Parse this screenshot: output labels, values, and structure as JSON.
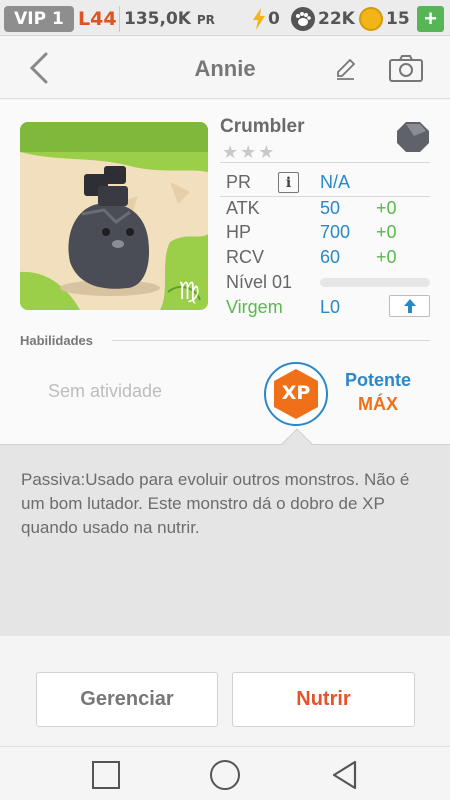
{
  "status_bar": {
    "vip": "VIP 1",
    "level": "L44",
    "pr_value": "135,0K",
    "pr_unit": "PR",
    "energy": "0",
    "paw_count": "22K",
    "coins": "15",
    "plus": "+"
  },
  "header": {
    "title": "Annie"
  },
  "monster": {
    "name": "Crumbler",
    "stars": "★★★",
    "sign_icon": "♍",
    "stats": {
      "pr_label": "PR",
      "pr_info": "i",
      "pr_value": "N/A",
      "atk_label": "ATK",
      "atk_value": "50",
      "atk_bonus": "+0",
      "hp_label": "HP",
      "hp_value": "700",
      "hp_bonus": "+0",
      "rcv_label": "RCV",
      "rcv_value": "60",
      "rcv_bonus": "+0",
      "level_label": "Nível 01",
      "level_progress": 0.0,
      "sign_label": "Virgem",
      "sign_value": "L0"
    }
  },
  "abilities": {
    "section_label": "Habilidades",
    "empty_text": "Sem atividade",
    "xp_badge": "XP",
    "potency_label": "Potente",
    "potency_value": "MÁX"
  },
  "description": "Passiva:Usado para evoluir outros monstros. Não é um bom lutador. Este monstro dá o dobro de XP quando usado na nutrir.",
  "actions": {
    "manage": "Gerenciar",
    "feed": "Nutrir"
  },
  "colors": {
    "accent_blue": "#2b88c8",
    "bonus_green": "#58b94c",
    "feed_orange": "#e2552a",
    "xp_orange": "#f07019"
  }
}
